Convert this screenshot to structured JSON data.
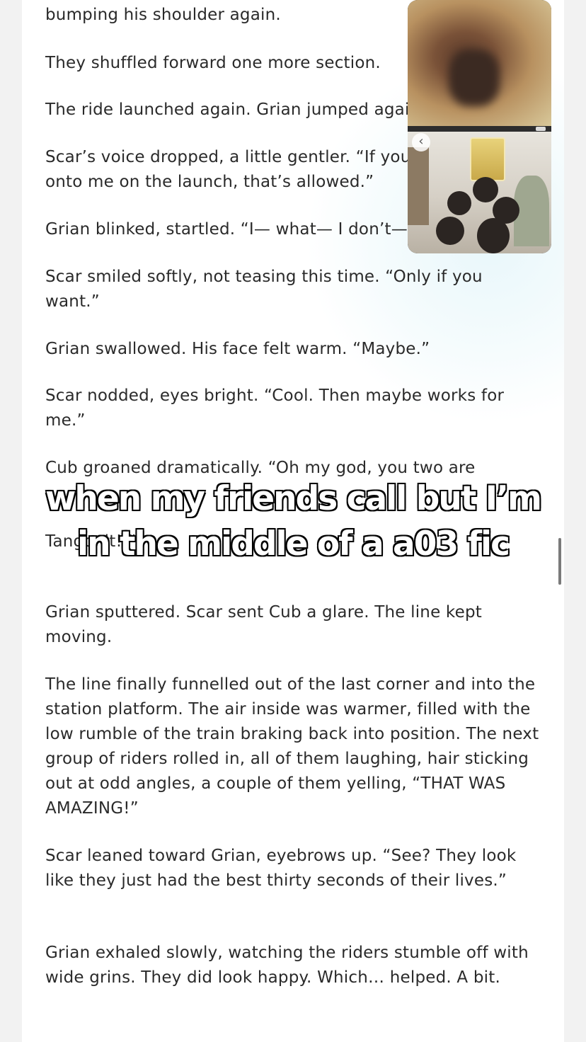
{
  "story": {
    "paragraphs": [
      "bumping his shoulder again.",
      "They shuffled forward one more section.",
      "The ride launched again. Grian jumped again.",
      "Scar’s voice dropped, a little gentler. “If you want to hold onto me on the launch, that’s allowed.”",
      "Grian blinked, startled. “I— what— I don’t—”",
      "Scar smiled softly, not teasing this time. “Only if you want.”",
      "Grian swallowed. His face felt warm. “Maybe.”",
      "Scar nodded, eyes bright. “Cool. Then maybe works for me.”",
      "Cub groaned dramatically. “Oh my god, you two are",
      "Tango, it! ”",
      "Grian sputtered. Scar sent Cub a glare. The line kept moving.",
      "The line finally funnelled out of the last corner and into the station platform. The air inside was warmer, filled with the low rumble of the train braking back into position. The next group of riders rolled in, all of them laughing, hair sticking out at odd angles, a couple of them yelling, “THAT WAS AMAZING!”",
      "Scar leaned toward Grian, eyebrows up. “See? They look like they just had the best thirty seconds of their lives.”",
      "Grian exhaled slowly, watching the riders stumble off with wide grins. They did look happy. Which… helped. A bit."
    ]
  },
  "overlay": {
    "caption_line1": "when my friends call but I’m",
    "caption_line2": "in the middle of a a03 fic"
  },
  "pip": {
    "back_glyph": "‹",
    "icons": [
      "chevron-left-icon"
    ]
  }
}
